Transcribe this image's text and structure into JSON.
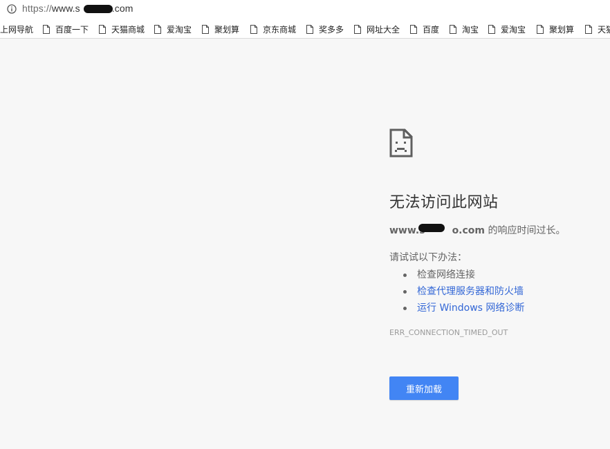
{
  "address_bar": {
    "icon": "info-icon",
    "url_scheme": "https://",
    "url_prefix": "www.s",
    "url_suffix": ".com"
  },
  "bookmarks": [
    {
      "label": "上网导航",
      "has_icon": false
    },
    {
      "label": "百度一下",
      "has_icon": true
    },
    {
      "label": "天猫商城",
      "has_icon": true
    },
    {
      "label": "爱淘宝",
      "has_icon": true
    },
    {
      "label": "聚划算",
      "has_icon": true
    },
    {
      "label": "京东商城",
      "has_icon": true
    },
    {
      "label": "奖多多",
      "has_icon": true
    },
    {
      "label": "网址大全",
      "has_icon": true
    },
    {
      "label": "百度",
      "has_icon": true
    },
    {
      "label": "淘宝",
      "has_icon": true
    },
    {
      "label": "爱淘宝",
      "has_icon": true
    },
    {
      "label": "聚划算",
      "has_icon": true
    },
    {
      "label": "天猫",
      "has_icon": true
    }
  ],
  "error": {
    "icon": "sad-page-icon",
    "title": "无法访问此网站",
    "host_prefix": "www.s",
    "host_suffix": "o.com",
    "description_tail": " 的响应时间过长。",
    "suggestions_heading": "请试试以下办法：",
    "suggestions": [
      {
        "text": "检查网络连接",
        "is_link": false
      },
      {
        "text": "检查代理服务器和防火墙",
        "is_link": true
      },
      {
        "text": "运行 Windows 网络诊断",
        "is_link": true
      }
    ],
    "error_code": "ERR_CONNECTION_TIMED_OUT",
    "reload_label": "重新加载"
  },
  "colors": {
    "page_background": "#f7f7f7",
    "button_blue": "#4285f4",
    "link_blue": "#3367d6",
    "text_gray": "#646464"
  }
}
